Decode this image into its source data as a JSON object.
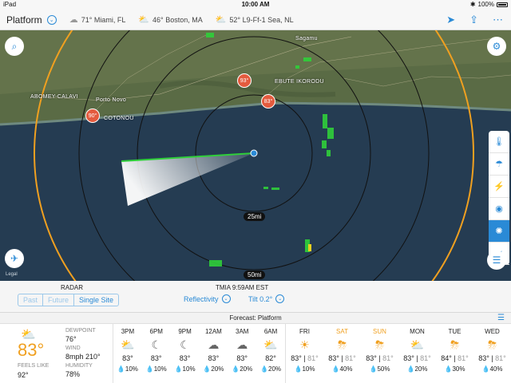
{
  "status_bar": {
    "device": "iPad",
    "time": "10:00 AM",
    "battery": "100%"
  },
  "nav": {
    "title": "Platform",
    "locations": [
      {
        "icon": "cloud-icon",
        "temp": "71°",
        "name": "Miami, FL"
      },
      {
        "icon": "partly-sunny-icon",
        "temp": "46°",
        "name": "Boston, MA"
      },
      {
        "icon": "partly-sunny-icon",
        "temp": "52°",
        "name": "L9-Ff-1 Sea, NL"
      }
    ]
  },
  "map": {
    "labels": {
      "sagamu": "Sagamu",
      "ebute": "EBUTE IKORODU",
      "abomey": "ABOMEY-CALAVI",
      "porto": "Porto Novo",
      "cotonou": "COTONOU"
    },
    "rings": {
      "r25": "25mi",
      "r50": "50mi"
    },
    "pins": {
      "p1": "90°",
      "p2": "93°",
      "p3": "83°"
    },
    "legal": "Legal"
  },
  "controls": {
    "radar_label": "RADAR",
    "site_label": "TMIA 9:59AM EST",
    "modes": [
      "Past",
      "Future",
      "Single Site"
    ],
    "product": "Reflectivity",
    "tilt": "Tilt 0.2°"
  },
  "forecast": {
    "header": "Forecast: Platform",
    "current": {
      "temp": "83°",
      "feels_like_label": "FEELS LIKE",
      "feels_like": "92°",
      "dewpoint_label": "DEWPOINT",
      "dewpoint": "76°",
      "wind_label": "WIND",
      "wind": "8mph 210°",
      "humidity_label": "HUMIDITY",
      "humidity": "78%"
    },
    "hourly": [
      {
        "time": "3PM",
        "icon": "partly-sunny-icon",
        "temp": "83°",
        "precip": "10%"
      },
      {
        "time": "6PM",
        "icon": "partly-cloudy-night-icon",
        "temp": "83°",
        "precip": "10%"
      },
      {
        "time": "9PM",
        "icon": "moon-icon",
        "temp": "83°",
        "precip": "10%"
      },
      {
        "time": "12AM",
        "icon": "partly-cloudy-night-icon",
        "temp": "83°",
        "precip": "20%"
      },
      {
        "time": "3AM",
        "icon": "partly-cloudy-night-icon",
        "temp": "83°",
        "precip": "20%"
      },
      {
        "time": "6AM",
        "icon": "partly-sunny-icon",
        "temp": "82°",
        "precip": "20%"
      }
    ],
    "daily": [
      {
        "day": "FRI",
        "icon": "sunny-icon",
        "high": "83°",
        "low": "81°",
        "precip": "10%",
        "weekend": false
      },
      {
        "day": "SAT",
        "icon": "thunderstorm-icon",
        "high": "83°",
        "low": "81°",
        "precip": "40%",
        "weekend": true
      },
      {
        "day": "SUN",
        "icon": "thunderstorm-icon",
        "high": "83°",
        "low": "81°",
        "precip": "50%",
        "weekend": true
      },
      {
        "day": "MON",
        "icon": "partly-sunny-icon",
        "high": "83°",
        "low": "81°",
        "precip": "20%",
        "weekend": false
      },
      {
        "day": "TUE",
        "icon": "thunderstorm-icon",
        "high": "84°",
        "low": "81°",
        "precip": "30%",
        "weekend": false
      },
      {
        "day": "WED",
        "icon": "thunderstorm-icon",
        "high": "83°",
        "low": "81°",
        "precip": "40%",
        "weekend": false
      }
    ]
  },
  "colors": {
    "accent": "#2a8ad6",
    "sun": "#f0a020",
    "pin": "#e45b3e",
    "radar": "#2fcf3a"
  }
}
